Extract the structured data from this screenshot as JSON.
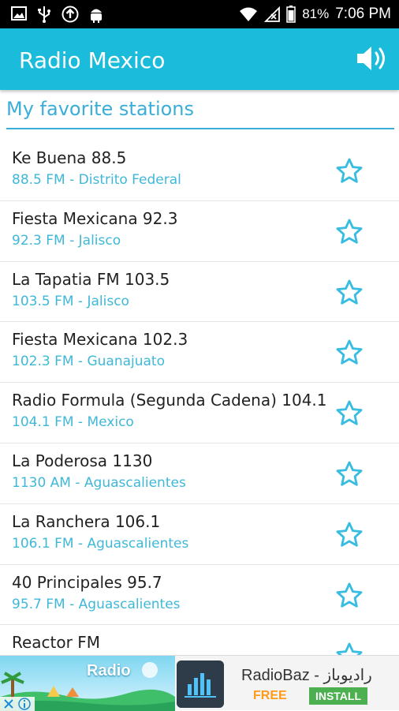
{
  "status_bar": {
    "battery": "81%",
    "time": "7:06 PM",
    "left_icons": [
      "image-icon",
      "usb-icon",
      "upload-circle-icon",
      "android-icon"
    ],
    "right_icons": [
      "wifi-icon",
      "no-signal-icon",
      "battery-icon"
    ]
  },
  "app_bar": {
    "title": "Radio Mexico",
    "action_icon": "volume-icon",
    "color": "#1bbcdb"
  },
  "section": {
    "title": "My favorite stations"
  },
  "stations": [
    {
      "name": "Ke Buena 88.5",
      "sub": "88.5 FM - Distrito Federal"
    },
    {
      "name": "Fiesta Mexicana 92.3",
      "sub": "92.3 FM - Jalisco"
    },
    {
      "name": "La Tapatia FM 103.5",
      "sub": "103.5 FM - Jalisco"
    },
    {
      "name": "Fiesta Mexicana 102.3",
      "sub": "102.3 FM - Guanajuato"
    },
    {
      "name": "Radio Formula (Segunda Cadena) 104.1",
      "sub": "104.1 FM - Mexico"
    },
    {
      "name": "La Poderosa 1130",
      "sub": "1130 AM - Aguascalientes"
    },
    {
      "name": "La Ranchera 106.1",
      "sub": "106.1 FM - Aguascalientes"
    },
    {
      "name": "40 Principales 95.7",
      "sub": "95.7 FM - Aguascalientes"
    },
    {
      "name": "Reactor FM",
      "sub": ""
    }
  ],
  "ad": {
    "banner_text": "Radio",
    "title": "RadioBaz - راديوباز",
    "free_label": "FREE",
    "install_label": "INSTALL"
  },
  "colors": {
    "accent": "#3aaed8",
    "subtitle": "#3fb8d8",
    "star": "#38bde0"
  }
}
